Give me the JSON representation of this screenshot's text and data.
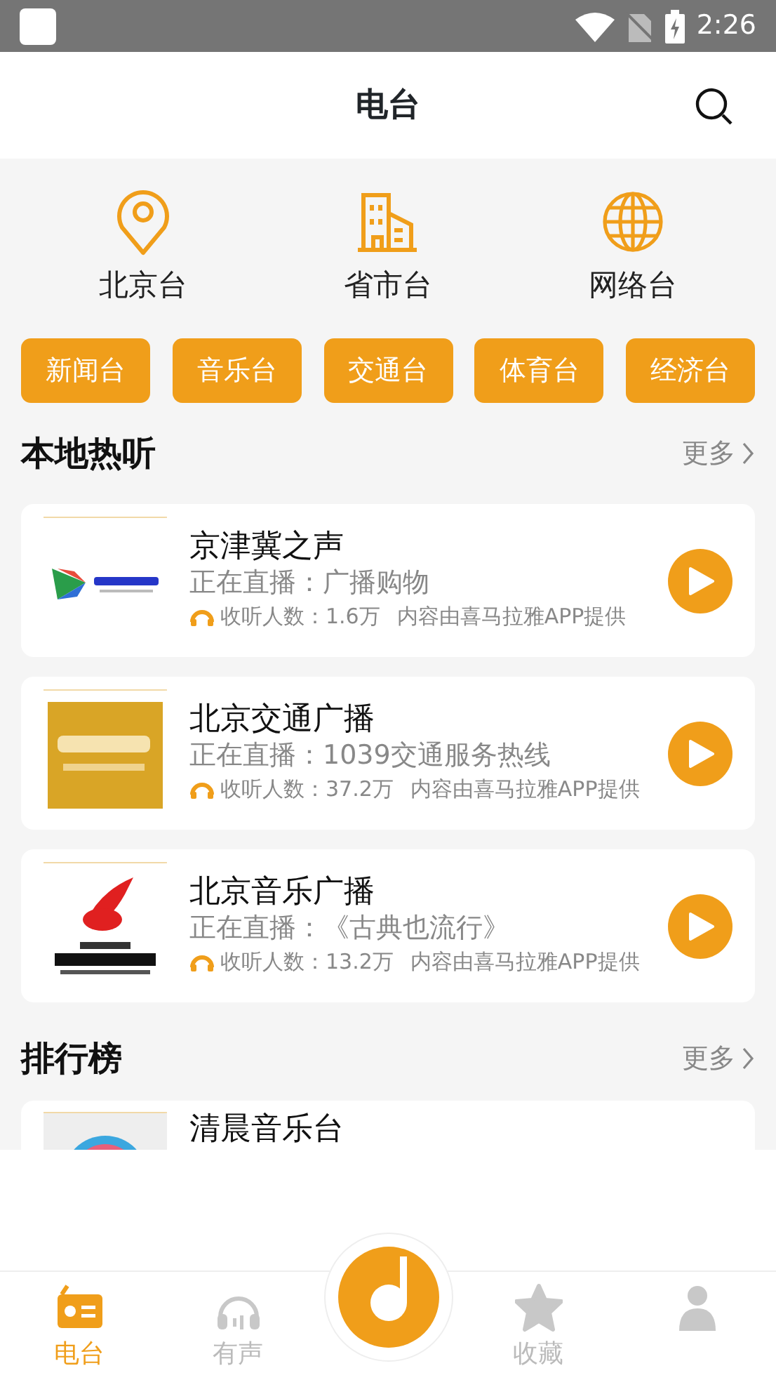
{
  "status_bar": {
    "time": "2:26"
  },
  "header": {
    "title": "电台"
  },
  "region_tabs": [
    {
      "label": "北京台",
      "kind": "location"
    },
    {
      "label": "省市台",
      "kind": "building"
    },
    {
      "label": "网络台",
      "kind": "globe"
    }
  ],
  "categories": [
    "新闻台",
    "音乐台",
    "交通台",
    "体育台",
    "经济台"
  ],
  "local_section": {
    "title": "本地热听",
    "more": "更多"
  },
  "stations": [
    {
      "name": "京津冀之声",
      "now_playing": "正在直播：广播购物",
      "listeners": "收听人数：1.6万",
      "provider": "内容由喜马拉雅APP提供",
      "kind": "picture"
    },
    {
      "name": "北京交通广播",
      "now_playing": "正在直播：1039交通服务热线",
      "listeners": "收听人数：37.2万",
      "provider": "内容由喜马拉雅APP提供",
      "kind": "picture"
    },
    {
      "name": "北京音乐广播",
      "now_playing": "正在直播：《古典也流行》",
      "listeners": "收听人数：13.2万",
      "provider": "内容由喜马拉雅APP提供",
      "kind": "picture"
    }
  ],
  "ranking_section": {
    "title": "排行榜",
    "more": "更多",
    "stations": [
      {
        "name": "清晨音乐台",
        "kind": "picture"
      }
    ]
  },
  "nav_tabs": [
    {
      "label": "电台",
      "kind": "radio",
      "selected": true
    },
    {
      "label": "有声",
      "kind": "headphones",
      "selected": false
    },
    {
      "kind": "player",
      "selected": false
    },
    {
      "label": "收藏",
      "kind": "star",
      "selected": false
    },
    {
      "kind": "person",
      "selected": false
    }
  ]
}
